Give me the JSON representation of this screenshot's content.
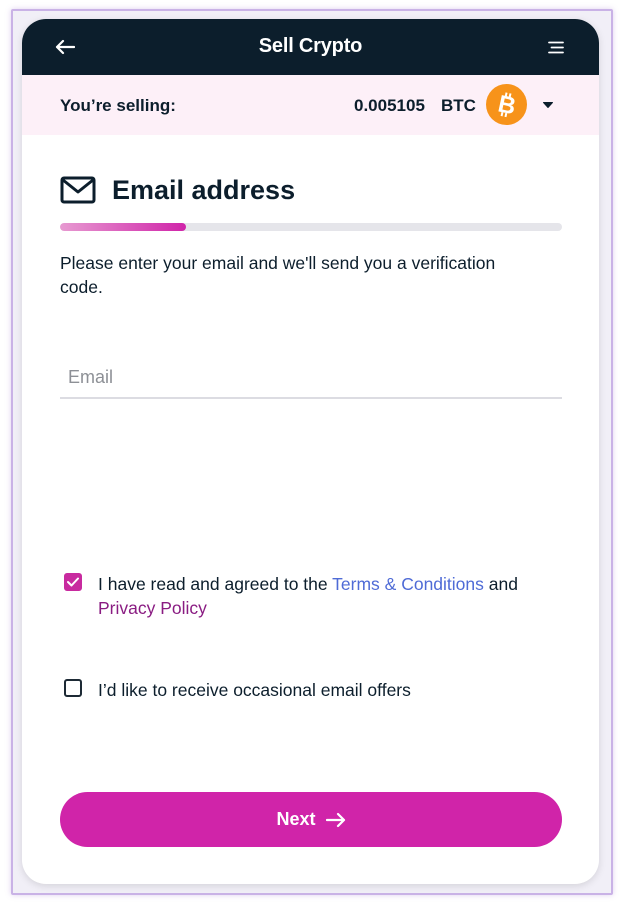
{
  "header": {
    "title": "Sell Crypto",
    "back_icon": "arrow-left-icon",
    "menu_icon": "menu-icon"
  },
  "selling": {
    "label": "You’re selling:",
    "amount": "0.005105",
    "currency": "BTC",
    "coin_icon": "bitcoin-icon",
    "coin_color": "#f7931a",
    "dropdown_icon": "caret-down-icon"
  },
  "section": {
    "icon": "mail-icon",
    "title": "Email address",
    "progress_fraction": 0.25,
    "description": "Please enter your email and we'll send you a verification code."
  },
  "email": {
    "placeholder": "Email",
    "value": ""
  },
  "terms": {
    "checked": true,
    "text_before": "I have read and agreed to the ",
    "terms_link": "Terms & Conditions",
    "text_mid": " and ",
    "privacy_link": "Privacy Policy"
  },
  "offers": {
    "checked": false,
    "label": "I’d like to receive occasional email offers"
  },
  "next_button": {
    "label": "Next",
    "icon": "arrow-right-icon"
  },
  "colors": {
    "accent": "#d024a9",
    "header_bg": "#0c1e2c",
    "link_blue": "#4f6bd6",
    "link_pink": "#8a1c82"
  }
}
